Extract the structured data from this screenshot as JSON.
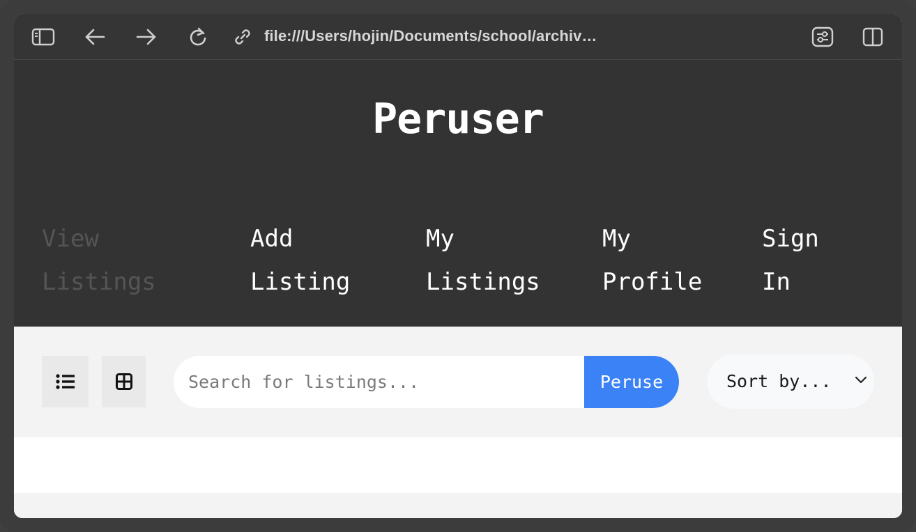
{
  "browser": {
    "url": "file:///Users/hojin/Documents/school/archiv…",
    "icons": {
      "sidebar": "sidebar-icon",
      "back": "back-arrow-icon",
      "forward": "forward-arrow-icon",
      "reload": "reload-icon",
      "link": "link-icon",
      "page_settings": "page-settings-icon",
      "split_view": "split-view-icon"
    }
  },
  "header": {
    "title": "Peruser"
  },
  "nav": {
    "items": [
      {
        "label": "View\nListings",
        "active": true
      },
      {
        "label": "Add\nListing",
        "active": false
      },
      {
        "label": "My\nListings",
        "active": false
      },
      {
        "label": "My\nProfile",
        "active": false
      },
      {
        "label": "Sign\nIn",
        "active": false
      }
    ]
  },
  "controls": {
    "list_view_icon": "list-view-icon",
    "grid_view_icon": "grid-view-icon",
    "search": {
      "placeholder": "Search for listings...",
      "value": "",
      "button_label": "Peruse"
    },
    "sort": {
      "selected": "Sort by...",
      "icon": "chevron-down-icon"
    }
  },
  "colors": {
    "header_bg": "#333333",
    "accent": "#3b82f6",
    "nav_active": "#555555"
  }
}
